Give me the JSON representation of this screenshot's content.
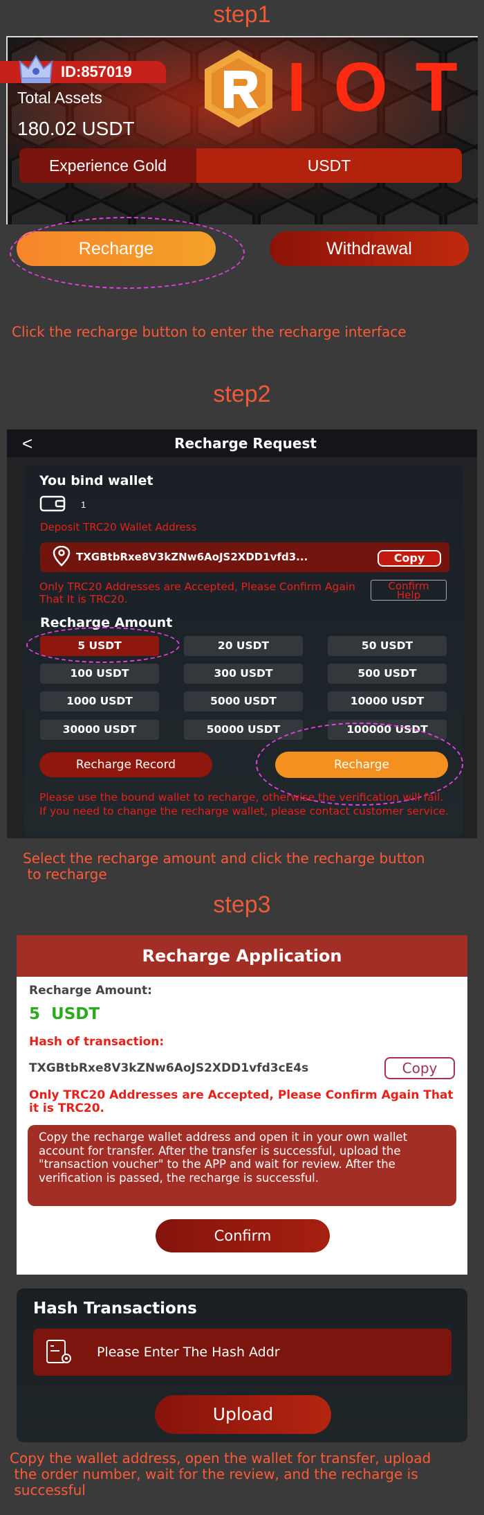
{
  "step1": {
    "title": "step1",
    "user_id": "ID:857019",
    "total_assets_label": "Total Assets",
    "total_assets_value": "180.02 USDT",
    "logo_text": "IOT",
    "tab_experience": "Experience Gold",
    "tab_usdt": "USDT",
    "recharge_button": "Recharge",
    "withdrawal_button": "Withdrawal",
    "caption": "Click the recharge button to enter the recharge interface"
  },
  "step2": {
    "title": "step2",
    "back_icon": "chevron-left-icon",
    "header_title": "Recharge Request",
    "bind_wallet_title": "You bind wallet",
    "wallet_count": "1",
    "deposit_label": "Deposit TRC20 Wallet Address",
    "address": "TXGBtbRxe8V3kZNw6AoJS2XDD1vfd3...",
    "copy_button": "Copy",
    "only_trc_note": "Only TRC20 Addresses are Accepted, Please Confirm Again That It is TRC20.",
    "confirm_overlay": "Confirm",
    "help_overlay": "Help",
    "recharge_amount_title": "Recharge Amount",
    "amounts": [
      "5 USDT",
      "20 USDT",
      "50 USDT",
      "100 USDT",
      "300 USDT",
      "500 USDT",
      "1000 USDT",
      "5000 USDT",
      "10000 USDT",
      "30000 USDT",
      "50000 USDT",
      "100000 USDT"
    ],
    "selected_amount": "5 USDT",
    "recharge_record_button": "Recharge Record",
    "recharge_button": "Recharge",
    "bind_note": "Please use the bound wallet to recharge, otherwise the verification will fail. If you need to change the recharge wallet, please contact customer service.",
    "caption": "Select the recharge amount and click the recharge button\n to recharge"
  },
  "step3": {
    "title": "step3",
    "header_title": "Recharge Application",
    "recharge_amount_label": "Recharge Amount:",
    "recharge_amount_value": "5  USDT",
    "hash_label": "Hash of transaction:",
    "hash_value": "TXGBtbRxe8V3kZNw6AoJS2XDD1vfd3cE4s",
    "copy_button": "Copy",
    "only_trc_note": "Only TRC20 Addresses are Accepted, Please Confirm Again That it is TRC20.",
    "instruction": "Copy the recharge wallet address and open it in your own wallet account for transfer. After the transfer is successful, upload the \"transaction voucher\" to the APP and wait for review. After the verification is passed, the recharge is successful.",
    "confirm_button": "Confirm",
    "hash_transactions_title": "Hash Transactions",
    "hash_input_placeholder": "Please Enter The Hash Addr",
    "upload_button": "Upload",
    "caption": "Copy the wallet address, open the wallet for transfer, upload\n the order number, wait for the review, and the recharge is\n successful"
  },
  "colors": {
    "accent_orange": "#f4901f",
    "dark_red": "#8f180e",
    "caption_red": "#ff5a36",
    "success_green": "#2aaa1c"
  }
}
